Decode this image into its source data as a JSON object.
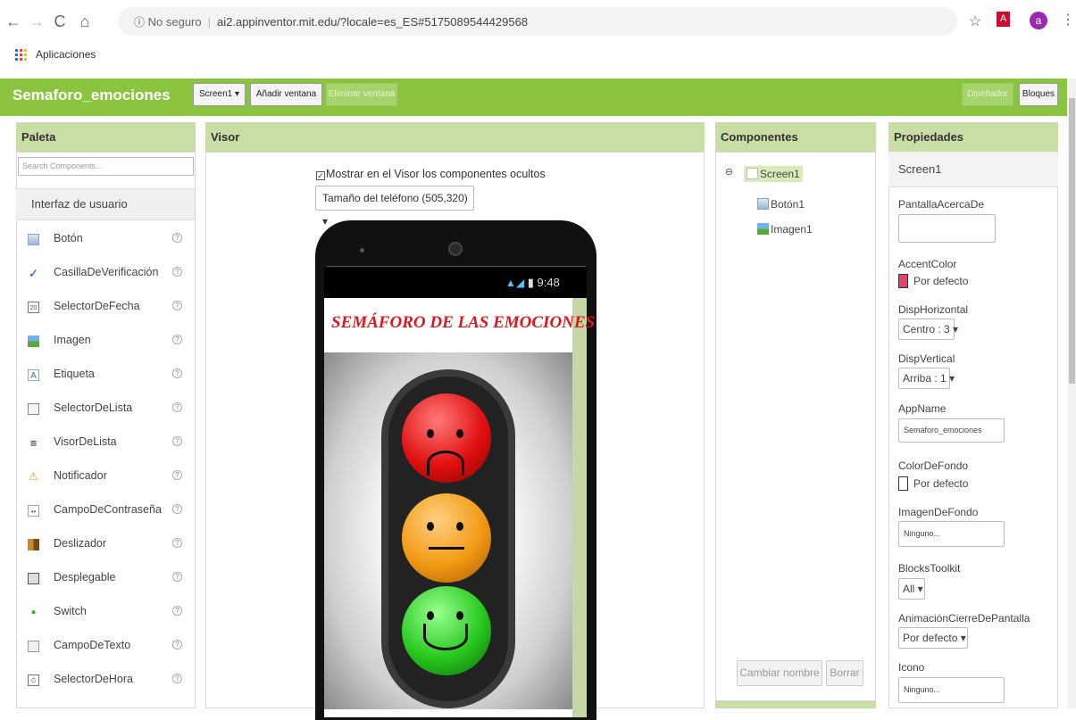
{
  "browser": {
    "url_security": "No seguro",
    "url": "ai2.appinventor.mit.edu/?locale=es_ES#5175089544429568",
    "bookmarks_label": "Aplicaciones",
    "profile_initial": "a"
  },
  "header": {
    "project_name": "Semaforo_emociones",
    "screen_select": "Screen1 ▾",
    "add_screen": "Añadir ventana",
    "remove_screen": "Eliminar ventana",
    "designer": "Diseñador",
    "blocks": "Bloques"
  },
  "palette": {
    "title": "Paleta",
    "search_placeholder": "Search Components...",
    "category": "Interfaz de usuario",
    "items": [
      {
        "label": "Botón",
        "icon": "button-icon"
      },
      {
        "label": "CasillaDeVerificación",
        "icon": "checkbox-icon"
      },
      {
        "label": "SelectorDeFecha",
        "icon": "datepicker-icon"
      },
      {
        "label": "Imagen",
        "icon": "image-icon"
      },
      {
        "label": "Etiqueta",
        "icon": "label-icon"
      },
      {
        "label": "SelectorDeLista",
        "icon": "listpicker-icon"
      },
      {
        "label": "VisorDeLista",
        "icon": "listview-icon"
      },
      {
        "label": "Notificador",
        "icon": "notifier-icon"
      },
      {
        "label": "CampoDeContraseña",
        "icon": "passwordtextbox-icon"
      },
      {
        "label": "Deslizador",
        "icon": "slider-icon"
      },
      {
        "label": "Desplegable",
        "icon": "spinner-icon"
      },
      {
        "label": "Switch",
        "icon": "switch-icon"
      },
      {
        "label": "CampoDeTexto",
        "icon": "textbox-icon"
      },
      {
        "label": "SelectorDeHora",
        "icon": "timepicker-icon"
      }
    ]
  },
  "viewer": {
    "title": "Visor",
    "show_hidden_label": "Mostrar en el Visor los componentes ocultos",
    "phone_size": "Tamaño del teléfono (505,320)  ▾",
    "status_time": "9:48",
    "app_heading": "SEMÁFORO DE LAS EMOCIONES"
  },
  "components": {
    "title": "Componentes",
    "root": "Screen1",
    "children": [
      "Botón1",
      "Imagen1"
    ],
    "rename_button": "Cambiar nombre",
    "delete_button": "Borrar"
  },
  "properties": {
    "title": "Propiedades",
    "selected": "Screen1",
    "about_label": "PantallaAcercaDe",
    "accent_label": "AccentColor",
    "accent_value": "Por defecto",
    "accent_color": "#e8416a",
    "halign_label": "DispHorizontal",
    "halign_value": "Centro : 3 ▾",
    "valign_label": "DispVertical",
    "valign_value": "Arriba : 1 ▾",
    "appname_label": "AppName",
    "appname_value": "Semaforo_emociones",
    "bgcolor_label": "ColorDeFondo",
    "bgcolor_value": "Por defecto",
    "bgimage_label": "ImagenDeFondo",
    "bgimage_value": "Ninguno...",
    "toolkit_label": "BlocksToolkit",
    "toolkit_value": "All ▾",
    "anim_label": "AnimaciónCierreDePantalla",
    "anim_value": "Por defecto ▾",
    "icon_label": "Icono",
    "icon_value": "Ninguno..."
  }
}
